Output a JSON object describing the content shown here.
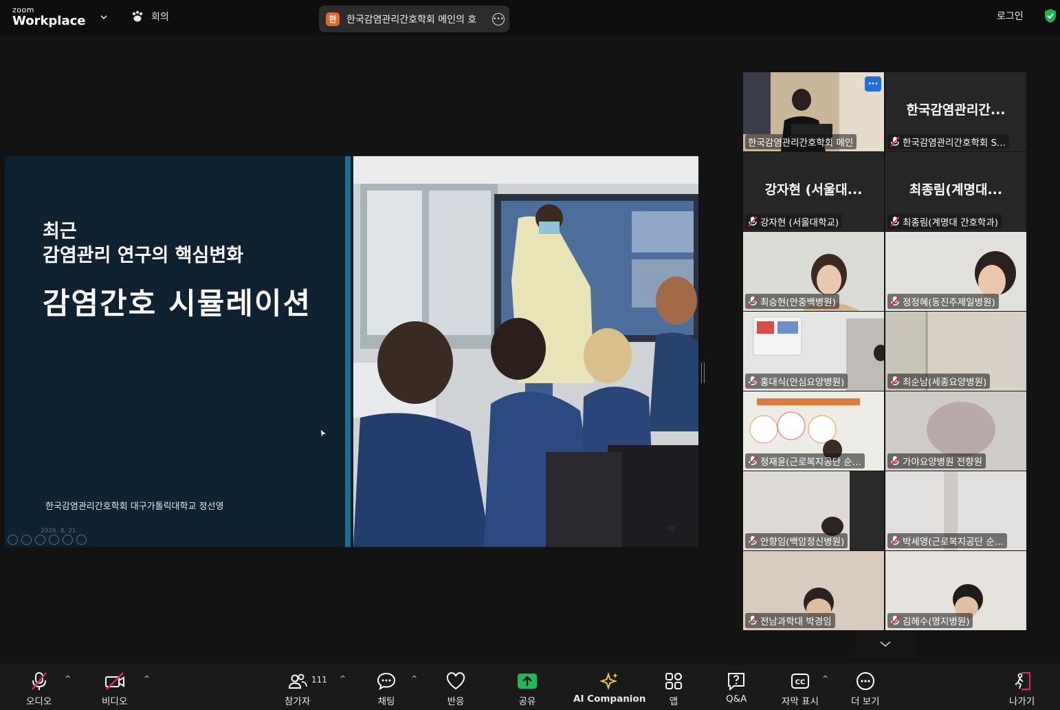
{
  "topbar": {
    "logo_small": "zoom",
    "logo_big": "Workplace",
    "meeting_tab": "회의",
    "meeting_avatar": "한",
    "meeting_title": "한국감염관리간호학회 메인의 호",
    "login": "로그인"
  },
  "slide": {
    "subtitle_line1": "최근",
    "subtitle_line2": "감염관리 연구의 핵심변화",
    "title": "감염간호 시뮬레이션",
    "author": "한국감염관리간호학회 대구가톨릭대학교 정선영",
    "date": "2026. 8. 21.",
    "page": "01"
  },
  "gallery": {
    "tiles": [
      {
        "label": "한국감염관리간호학회 메인"
      },
      {
        "big": "한국감염관리간...",
        "label": "한국감염관리간호학회 S..."
      },
      {
        "big": "강자현 (서울대...",
        "label": "강자현 (서울대학교)"
      },
      {
        "big": "최종림(계명대...",
        "label": "최종림(계명대 간호학과)"
      },
      {
        "label": "최승현(안중백병원)"
      },
      {
        "label": "정정혜(동진주제일병원)"
      },
      {
        "label": "홍대식(안심요양병원)"
      },
      {
        "label": "최순남(세종요양병원)"
      },
      {
        "label": "정재윤(근로복지공단 순..."
      },
      {
        "label": "가야요양병원 전향원"
      },
      {
        "label": "안향임(백암정신병원)"
      },
      {
        "label": "박세영(근로복지공단 순..."
      },
      {
        "label": "전남과학대 박경임"
      },
      {
        "label": "김혜수(명지병원)"
      }
    ]
  },
  "toolbar": {
    "audio": "오디오",
    "video": "비디오",
    "participants": "참가자",
    "participants_count": "111",
    "chat": "채팅",
    "react": "반응",
    "share": "공유",
    "ai": "AI Companion",
    "apps": "앱",
    "qa": "Q&A",
    "captions": "자막 표시",
    "more": "더 보기",
    "leave": "나가기"
  },
  "colors": {
    "accent_green": "#2cd07a",
    "share_green": "#1fb95a",
    "muted_red": "#e0245e",
    "ai_gold": "#f4c23d",
    "slide_navy": "#0f2232",
    "slide_teal": "#1b6e8e"
  }
}
